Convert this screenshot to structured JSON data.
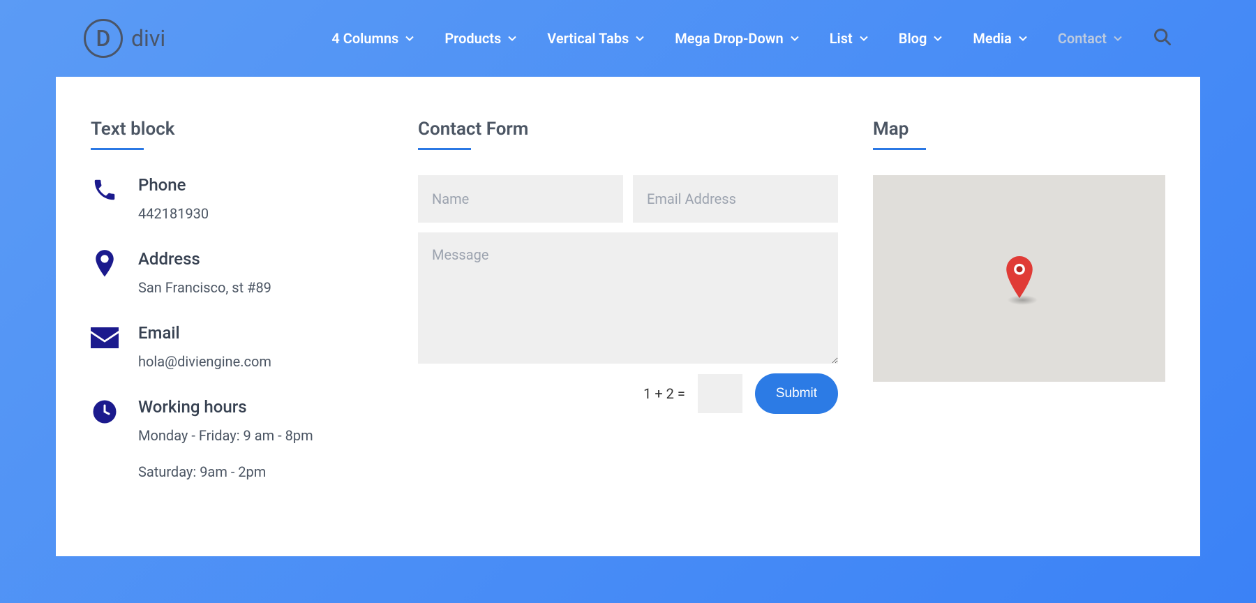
{
  "logo": {
    "letter": "D",
    "text": "divi"
  },
  "nav": {
    "items": [
      {
        "label": "4 Columns"
      },
      {
        "label": "Products"
      },
      {
        "label": "Vertical Tabs"
      },
      {
        "label": "Mega Drop-Down"
      },
      {
        "label": "List"
      },
      {
        "label": "Blog"
      },
      {
        "label": "Media"
      },
      {
        "label": "Contact"
      }
    ]
  },
  "sections": {
    "textblock": {
      "title": "Text block"
    },
    "contactform": {
      "title": "Contact Form"
    },
    "map": {
      "title": "Map"
    }
  },
  "info": {
    "phone": {
      "label": "Phone",
      "value": "442181930"
    },
    "address": {
      "label": "Address",
      "value": "San Francisco, st #89"
    },
    "email": {
      "label": "Email",
      "value": "hola@diviengine.com"
    },
    "hours": {
      "label": "Working hours",
      "line1": "Monday - Friday: 9 am - 8pm",
      "line2": "Saturday: 9am - 2pm"
    }
  },
  "form": {
    "name_placeholder": "Name",
    "email_placeholder": "Email Address",
    "message_placeholder": "Message",
    "captcha": "1 + 2 =",
    "submit": "Submit"
  }
}
